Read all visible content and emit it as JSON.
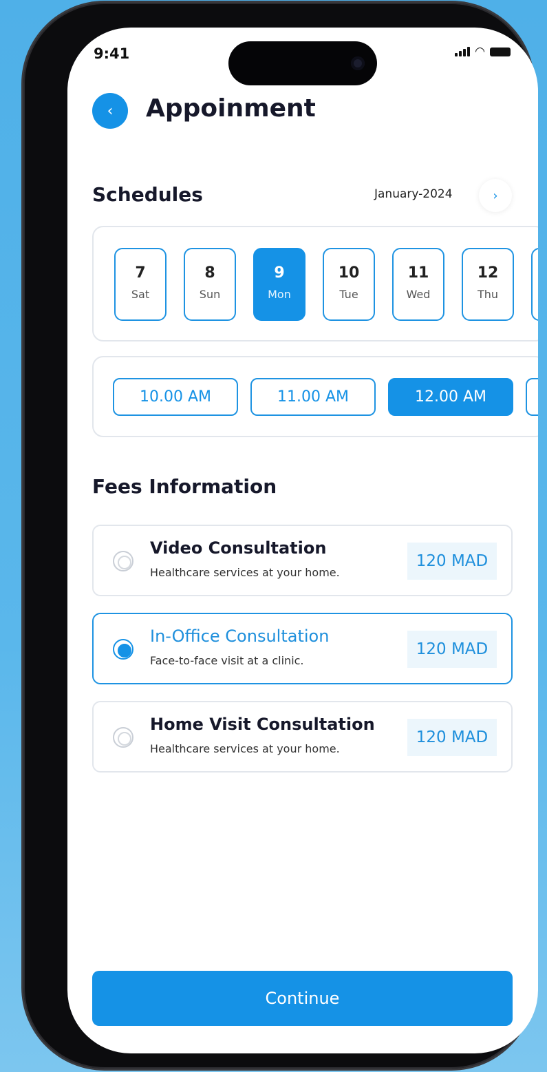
{
  "status_bar": {
    "time": "9:41"
  },
  "header": {
    "title": "Appoinment",
    "back_glyph": "‹",
    "back_icon": "chevron-left-icon"
  },
  "schedules": {
    "title": "Schedules",
    "month": "January-2024",
    "next_glyph": "›",
    "days": [
      {
        "num": "7",
        "dow": "Sat"
      },
      {
        "num": "8",
        "dow": "Sun"
      },
      {
        "num": "9",
        "dow": "Mon"
      },
      {
        "num": "10",
        "dow": "Tue"
      },
      {
        "num": "11",
        "dow": "Wed"
      },
      {
        "num": "12",
        "dow": "Thu"
      }
    ],
    "selected_day": "9",
    "times": [
      "10.00 AM",
      "11.00 AM",
      "12.00 AM"
    ],
    "selected_time": "12.00 AM"
  },
  "fees": {
    "title": "Fees Information",
    "options": [
      {
        "name": "Video Consultation",
        "desc": "Healthcare services at your home.",
        "price": "120 MAD",
        "selected": false
      },
      {
        "name": "In-Office Consultation",
        "desc": "Face-to-face visit at a clinic.",
        "price": "120 MAD",
        "selected": true
      },
      {
        "name": "Home Visit Consultation",
        "desc": "Healthcare services at your home.",
        "price": "120 MAD",
        "selected": false
      }
    ]
  },
  "footer": {
    "continue_label": "Continue"
  },
  "colors": {
    "accent": "#1592e6",
    "title": "#16182a",
    "price_bg": "#ecf6fc",
    "border": "#e2e6ec"
  }
}
